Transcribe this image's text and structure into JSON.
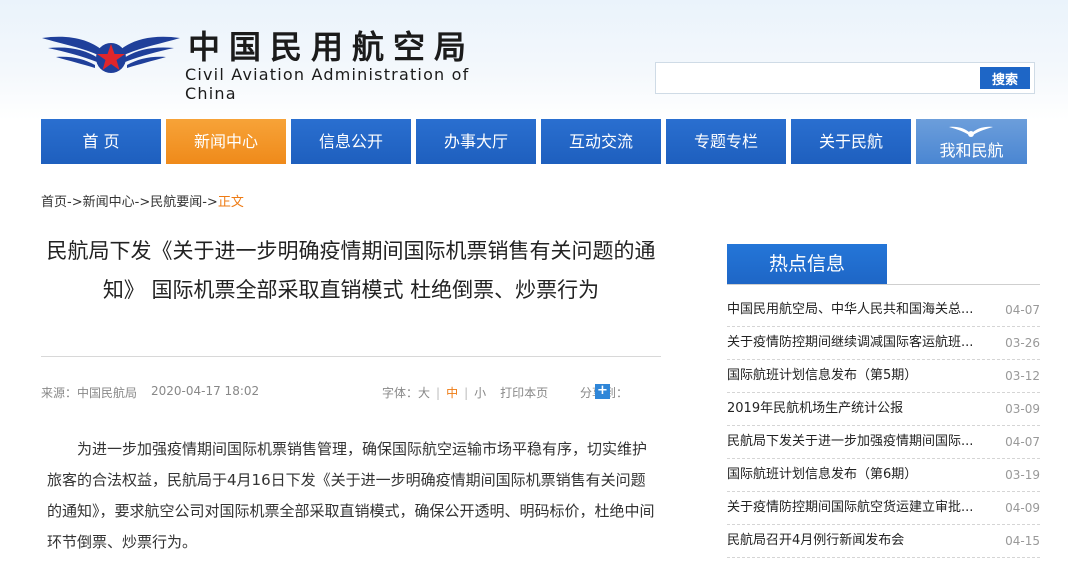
{
  "colors": {
    "nav_blue": "#1e5fbe",
    "nav_active": "#ef8a1a",
    "accent_orange": "#ee7b14",
    "search_button": "#1e66c6"
  },
  "logo": {
    "cn": "中国民用航空局",
    "en": "Civil Aviation Administration of China",
    "emblem": "caac-wings-star-icon"
  },
  "search": {
    "value": "",
    "placeholder": "",
    "button": "搜索"
  },
  "nav": [
    {
      "label": "首 页",
      "active": false
    },
    {
      "label": "新闻中心",
      "active": true
    },
    {
      "label": "信息公开",
      "active": false
    },
    {
      "label": "办事大厅",
      "active": false
    },
    {
      "label": "互动交流",
      "active": false
    },
    {
      "label": "专题专栏",
      "active": false
    },
    {
      "label": "关于民航",
      "active": false
    },
    {
      "label": "我和民航",
      "active": false
    }
  ],
  "breadcrumb": {
    "items": [
      "首页",
      "新闻中心",
      "民航要闻"
    ],
    "separator": "->",
    "current": "正文"
  },
  "article": {
    "title": "民航局下发《关于进一步明确疫情期间国际机票销售有关问题的通知》 国际机票全部采取直销模式 杜绝倒票、炒票行为",
    "source": "来源：中国民航局",
    "date": "2020-04-17 18:02",
    "font_label": "字体：",
    "font_large": "大",
    "font_medium": "中",
    "font_small": "小",
    "print": "打印本页",
    "share_label": "分享到：",
    "share_icon": "plus-icon",
    "body": "为进一步加强疫情期间国际机票销售管理，确保国际航空运输市场平稳有序，切实维护旅客的合法权益，民航局于4月16日下发《关于进一步明确疫情期间国际机票销售有关问题的通知》，要求航空公司对国际机票全部采取直销模式，确保公开透明、明码标价，杜绝中间环节倒票、炒票行为。"
  },
  "sidebar": {
    "title": "热点信息",
    "items": [
      {
        "title": "中国民用航空局、中华人民共和国海关总...",
        "date": "04-07"
      },
      {
        "title": "关于疫情防控期间继续调减国际客运航班...",
        "date": "03-26"
      },
      {
        "title": "国际航班计划信息发布（第5期）",
        "date": "03-12"
      },
      {
        "title": "2019年民航机场生产统计公报",
        "date": "03-09"
      },
      {
        "title": "民航局下发关于进一步加强疫情期间国际...",
        "date": "04-07"
      },
      {
        "title": "国际航班计划信息发布（第6期）",
        "date": "03-19"
      },
      {
        "title": "关于疫情防控期间国际航空货运建立审批...",
        "date": "04-09"
      },
      {
        "title": "民航局召开4月例行新闻发布会",
        "date": "04-15"
      }
    ]
  }
}
